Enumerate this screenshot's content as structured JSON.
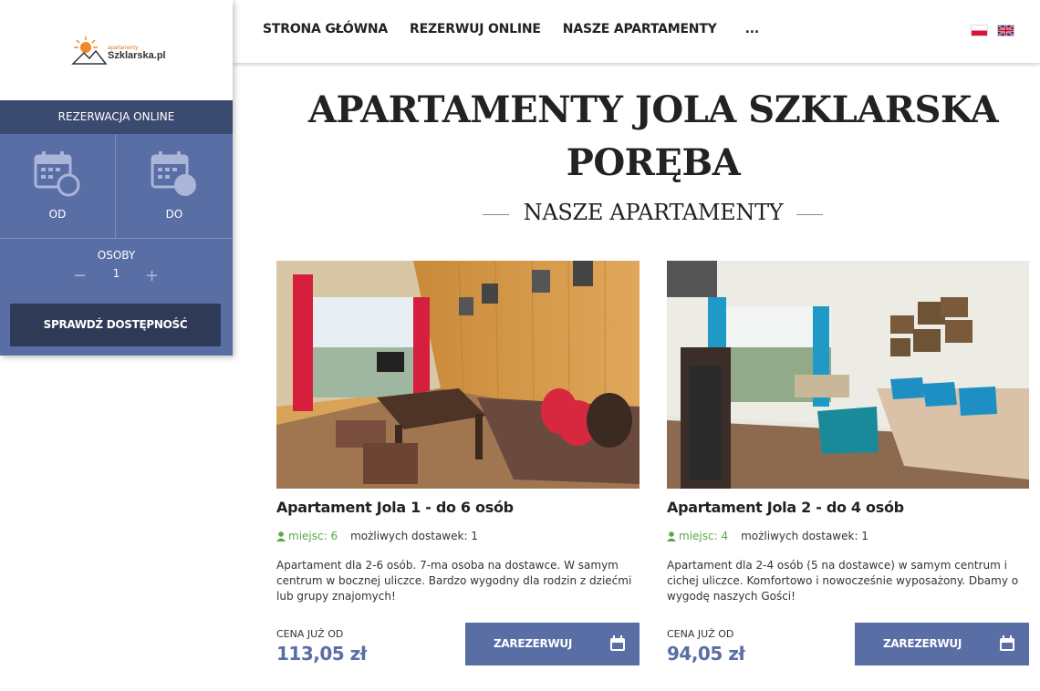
{
  "nav": {
    "items": [
      "STRONA GŁÓWNA",
      "REZERWUJ ONLINE",
      "NASZE APARTAMENTY",
      "..."
    ]
  },
  "logo": {
    "small": "apartamenty",
    "main": "Szklarska.pl"
  },
  "booking": {
    "header": "REZERWACJA ONLINE",
    "from_label": "OD",
    "to_label": "DO",
    "persons_label": "OSOBY",
    "persons_value": "1",
    "minus": "−",
    "plus": "+",
    "check_button": "SPRAWDŹ DOSTĘPNOŚĆ"
  },
  "main": {
    "title": "APARTAMENTY JOLA SZKLARSKA PORĘBA",
    "section": "NASZE APARTAMENTY",
    "cards": [
      {
        "title": "Apartament Jola 1 - do 6 osób",
        "places": "miejsc: 6",
        "extra": "możliwych dostawek: 1",
        "description": "Apartament dla 2-6 osób. 7-ma osoba na dostawce. W samym centrum w bocznej uliczce. Bardzo wygodny dla rodzin z dziećmi lub grupy znajomych!",
        "price_label": "CENA JUŻ OD",
        "price": "113,05 zł",
        "button": "ZAREZERWUJ"
      },
      {
        "title": "Apartament Jola 2 - do 4 osób",
        "places": "miejsc: 4",
        "extra": "możliwych dostawek: 1",
        "description": "Apartament dla 2-4 osób (5 na dostawce) w samym centrum i cichej uliczce. Komfortowo i nowocześnie wyposażony. Dbamy o wygodę naszych Gości!",
        "price_label": "CENA JUŻ OD",
        "price": "94,05 zł",
        "button": "ZAREZERWUJ"
      }
    ]
  },
  "colors": {
    "primary": "#5a6ea6",
    "dark": "#2f3a57",
    "header": "#3b4a6f",
    "green": "#5aa847"
  }
}
